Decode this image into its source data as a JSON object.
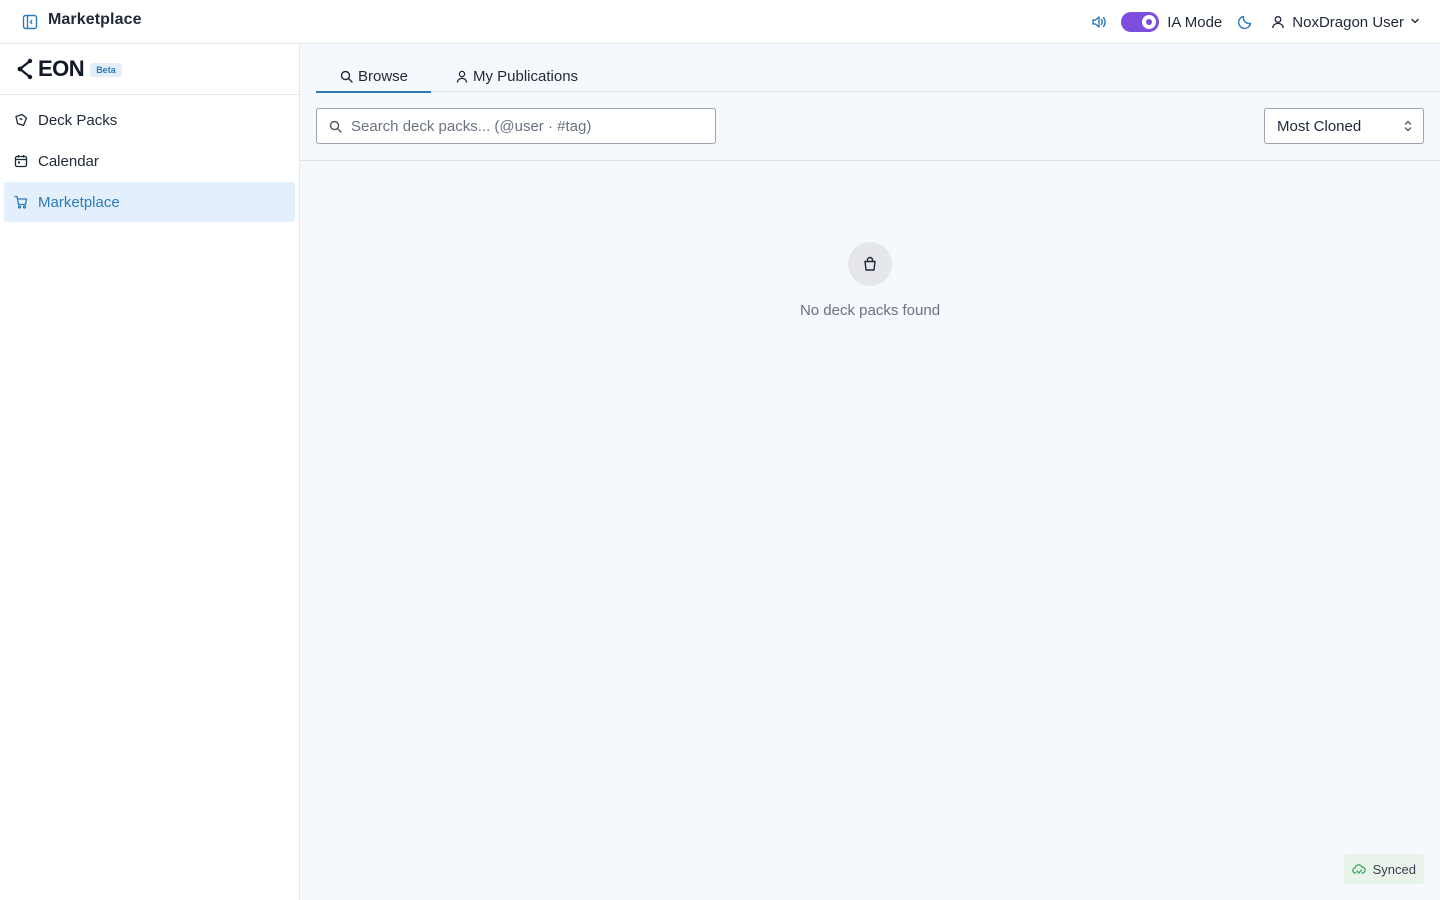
{
  "header": {
    "title": "Marketplace",
    "ia_mode_label": "IA Mode",
    "ia_mode_enabled": true,
    "user_name": "NoxDragon User"
  },
  "sidebar": {
    "brand_name": "EON",
    "badge": "Beta",
    "items": [
      {
        "label": "Deck Packs",
        "icon": "deck-pack-icon",
        "active": false
      },
      {
        "label": "Calendar",
        "icon": "calendar-icon",
        "active": false
      },
      {
        "label": "Marketplace",
        "icon": "cart-icon",
        "active": true
      }
    ]
  },
  "main": {
    "tabs": [
      {
        "label": "Browse",
        "icon": "search-icon",
        "active": true
      },
      {
        "label": "My Publications",
        "icon": "user-icon",
        "active": false
      }
    ],
    "search": {
      "placeholder": "Search deck packs... (@user · #tag)",
      "value": ""
    },
    "sort": {
      "selected": "Most Cloned"
    },
    "empty_state": {
      "message": "No deck packs found",
      "icon": "shopping-bag-icon"
    },
    "sync_status": "Synced"
  },
  "colors": {
    "accent": "#2b7bbd",
    "toggle": "#7c4dde",
    "sync_green": "#3aa55a"
  }
}
